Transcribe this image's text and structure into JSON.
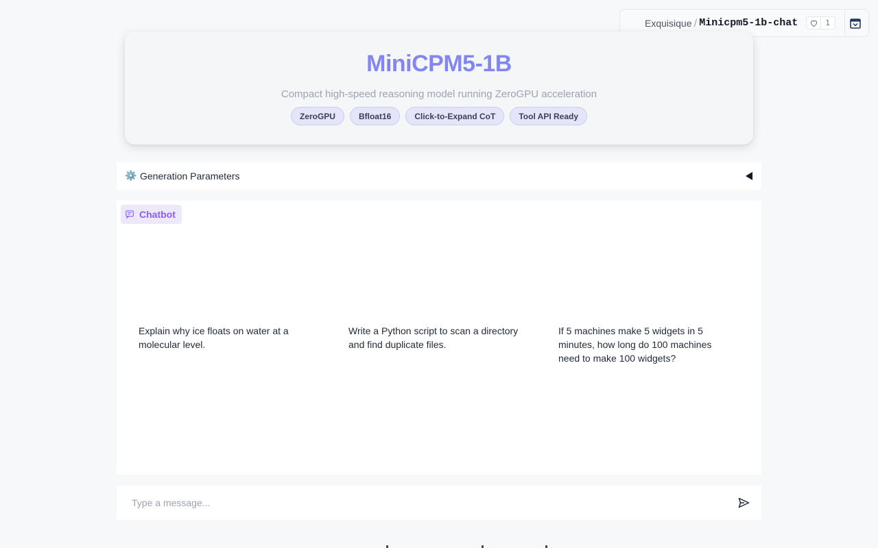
{
  "space": {
    "owner": "Exquisique",
    "separator": "/",
    "repo": "Minicpm5-1b-chat",
    "likes": "1"
  },
  "header": {
    "title": "MiniCPM5-1B",
    "subtitle": "Compact high-speed reasoning model running ZeroGPU acceleration",
    "badges": [
      "ZeroGPU",
      "Bfloat16",
      "Click-to-Expand CoT",
      "Tool API Ready"
    ]
  },
  "params": {
    "icon": "⚙️",
    "label": "Generation Parameters"
  },
  "chatbot": {
    "label": "Chatbot",
    "examples": [
      "Explain why ice floats on water at a molecular level.",
      "Write a Python script to scan a directory and find duplicate files.",
      "If 5 machines make 5 widgets in 5 minutes, how long do 100 machines need to make 100 widgets?"
    ]
  },
  "input": {
    "placeholder": "Type a message...",
    "value": ""
  },
  "colors": {
    "title_gradient_start": "#8b7ff0",
    "title_gradient_end": "#7b8cf0",
    "accent": "#8b5cf6",
    "badge_bg": "#e4e5f8"
  }
}
